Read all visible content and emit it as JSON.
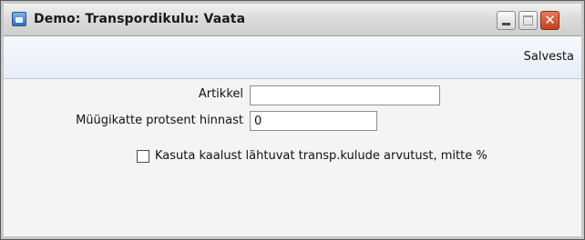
{
  "window": {
    "title": "Demo: Transpordikulu: Vaata",
    "app_icon": "app-window-icon",
    "controls": {
      "minimize_icon": "minimize-icon",
      "maximize_icon": "maximize-icon",
      "close_icon": "close-icon",
      "close_glyph": "✕"
    }
  },
  "toolbar": {
    "save_label": "Salvesta"
  },
  "form": {
    "article": {
      "label": "Artikkel",
      "value": ""
    },
    "margin_percent": {
      "label": "Müügikatte protsent hinnast",
      "value": "0"
    },
    "use_calculation": {
      "label": "Kasuta kaalust lähtuvat transp.kulude arvutust, mitte %",
      "checked": false
    }
  }
}
